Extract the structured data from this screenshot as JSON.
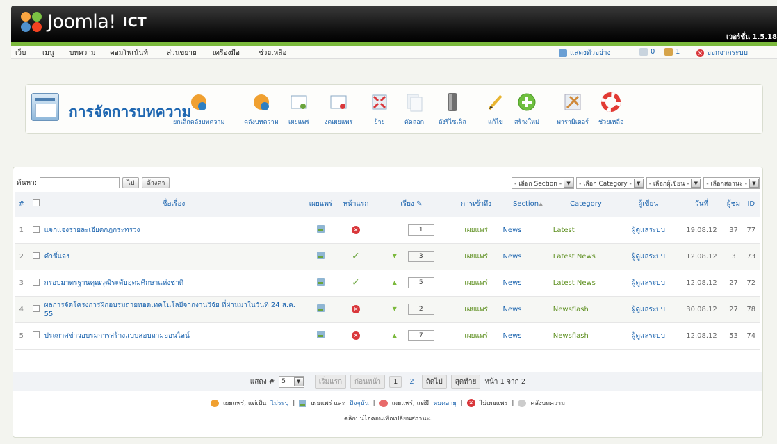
{
  "header": {
    "logo_text": "Joomla!",
    "site_name": "ICT",
    "version": "เวอร์ชั่น 1.5.18"
  },
  "menu": {
    "items": [
      "เว็บ",
      "เมนู",
      "บทความ",
      "คอมโพเน้นท์",
      "ส่วนขยาย",
      "เครื่องมือ",
      "ช่วยเหลือ"
    ],
    "preview": "แสดงตัวอย่าง",
    "messages_count": "0",
    "users_count": "1",
    "logout": "ออกจากระบบ"
  },
  "toolbar": {
    "title": "การจัดการบทความ",
    "buttons": [
      "ยกเลิกคลังบทความ",
      "คลังบทความ",
      "เผยแพร่",
      "งดเผยแพร่",
      "ย้าย",
      "คัดลอก",
      "ถังรีไซเคิล",
      "แก้ไข",
      "สร้างใหม่",
      "พารามิเตอร์",
      "ช่วยเหลือ"
    ]
  },
  "filter": {
    "label": "ค้นหา:",
    "go": "ไป",
    "reset": "ล้างค่า",
    "selects": [
      "- เลือก Section -",
      "- เลือก Category -",
      "- เลือกผู้เขียน -",
      "- เลือกสถานะ -"
    ]
  },
  "table": {
    "headers": {
      "num": "#",
      "title": "ชื่อเรื่อง",
      "published": "เผยแพร่",
      "front": "หน้าแรก",
      "order": "เรียง",
      "access": "การเข้าถึง",
      "section": "Section",
      "category": "Category",
      "author": "ผู้เขียน",
      "date": "วันที่",
      "hits": "ผู้ชม",
      "id": "ID"
    },
    "rows": [
      {
        "num": "1",
        "title": "แจกแจงรายละเอียดกฎกระทรวง",
        "order": "1",
        "access": "เผยแพร่",
        "section": "News",
        "category": "Latest",
        "author": "ผู้ดูแลระบบ",
        "date": "19.08.12",
        "hits": "37",
        "id": "77",
        "front": "no"
      },
      {
        "num": "2",
        "title": "คำชี้แจง",
        "order": "3",
        "access": "เผยแพร่",
        "section": "News",
        "category": "Latest News",
        "author": "ผู้ดูแลระบบ",
        "date": "12.08.12",
        "hits": "3",
        "id": "73",
        "front": "yes"
      },
      {
        "num": "3",
        "title": "กรอบมาตรฐานคุณวุฒิระดับอุดมศึกษาแห่งชาติ",
        "order": "5",
        "access": "เผยแพร่",
        "section": "News",
        "category": "Latest News",
        "author": "ผู้ดูแลระบบ",
        "date": "12.08.12",
        "hits": "27",
        "id": "72",
        "front": "yes"
      },
      {
        "num": "4",
        "title": "ผลการจัดโครงการฝึกอบรมถ่ายทอดเทคโนโลยีจากงานวิจัย ที่ผ่านมาในวันที่ 24 ส.ค. 55",
        "order": "2",
        "access": "เผยแพร่",
        "section": "News",
        "category": "Newsflash",
        "author": "ผู้ดูแลระบบ",
        "date": "30.08.12",
        "hits": "27",
        "id": "78",
        "front": "no"
      },
      {
        "num": "5",
        "title": "ประกาศข่าวอบรมการสร้างแบบสอบถามออนไลน์",
        "order": "7",
        "access": "เผยแพร่",
        "section": "News",
        "category": "Newsflash",
        "author": "ผู้ดูแลระบบ",
        "date": "12.08.12",
        "hits": "53",
        "id": "74",
        "front": "no"
      }
    ]
  },
  "pagination": {
    "display_label": "แสดง #",
    "display_value": "5",
    "start": "เริ่มแรก",
    "prev": "ก่อนหน้า",
    "page1": "1",
    "page2": "2",
    "next": "ถัดไป",
    "end": "สุดท้าย",
    "page_info": "หน้า 1 จาก 2"
  },
  "legend": {
    "l1": "เผยแพร่, แต่เป็น",
    "l1u": "ไม่ระบุ",
    "l2": "เผยแพร่ และ",
    "l2u": "ปัจจุบัน",
    "l3": "เผยแพร่, แต่มี",
    "l3u": "หมดอายุ",
    "l4": "ไม่เผยแพร่",
    "l5": "คลังบทความ",
    "note": "คลิกบนไอคอนเพื่อเปลี่ยนสถานะ."
  }
}
